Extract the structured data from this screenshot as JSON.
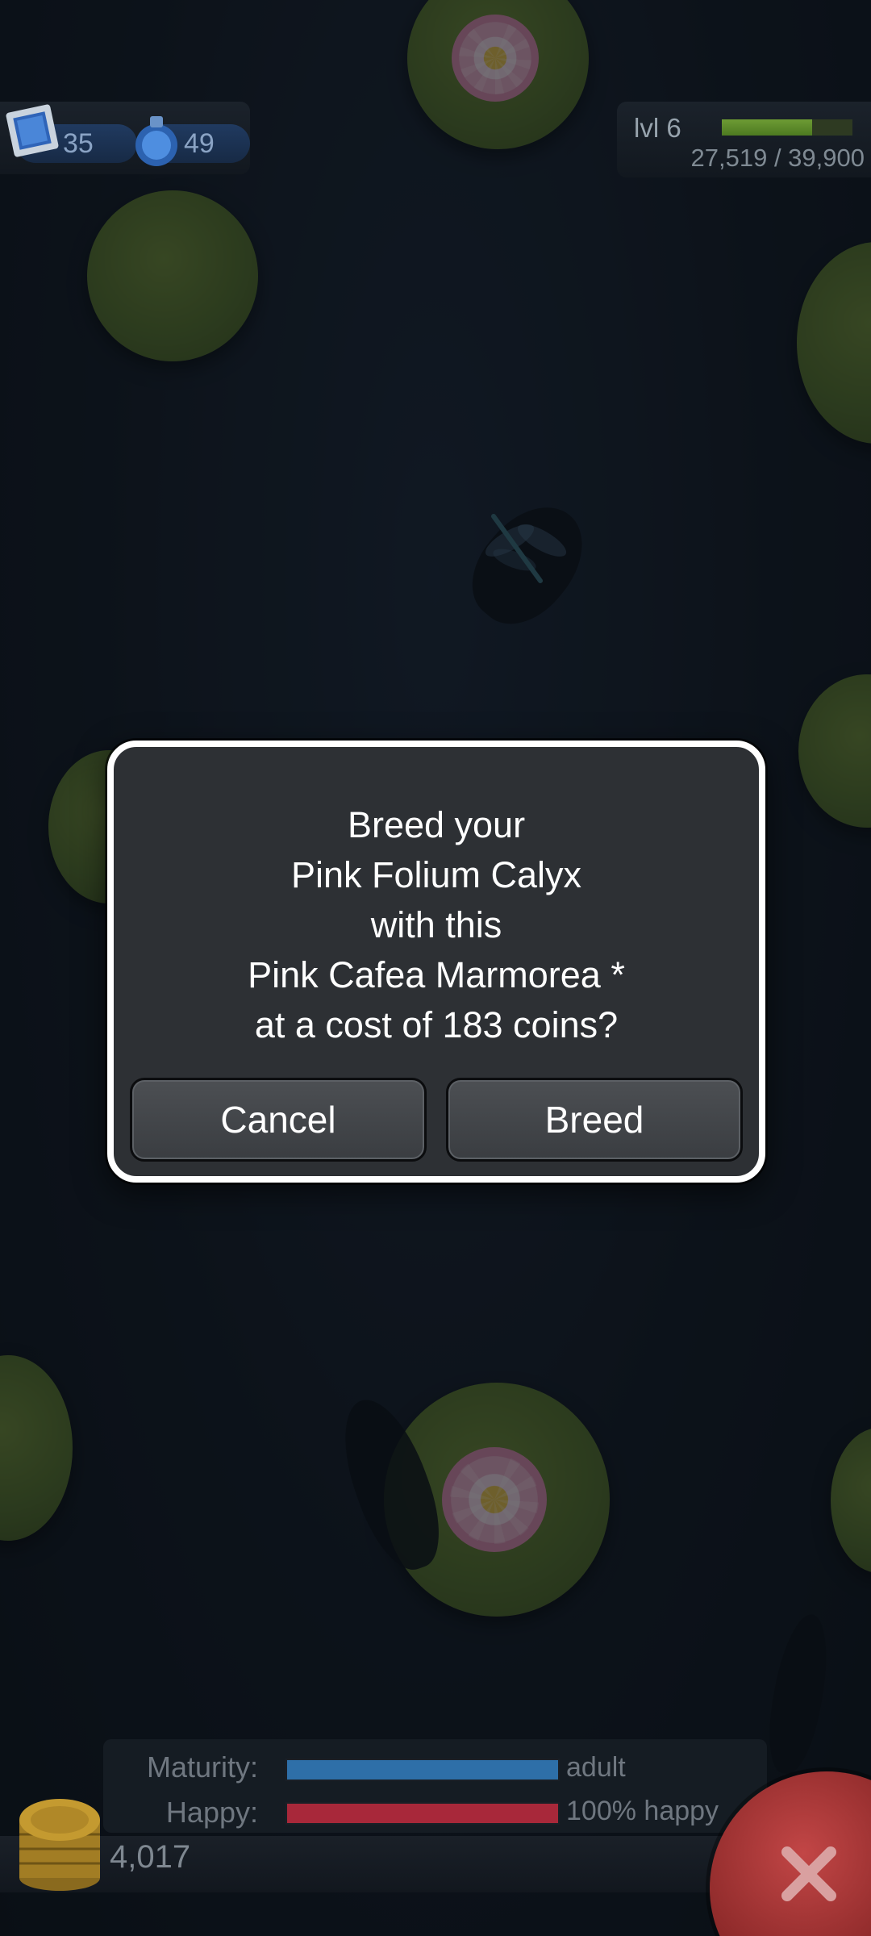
{
  "hud": {
    "stamps": "35",
    "potions": "49",
    "level_label": "lvl 6",
    "xp_text": "27,519 / 39,900",
    "xp_progress": 0.69
  },
  "dialog": {
    "lines": [
      "Breed your",
      "Pink Folium Calyx",
      "with this",
      "Pink Cafea Marmorea *",
      "at a cost of 183 coins?"
    ],
    "cancel_label": "Cancel",
    "breed_label": "Breed"
  },
  "stats": {
    "maturity_label": "Maturity:",
    "maturity_value": "adult",
    "maturity_progress": 1.0,
    "maturity_color": "#2e6fa8",
    "happy_label": "Happy:",
    "happy_value": "100% happy",
    "happy_progress": 1.0,
    "happy_color": "#a8283a"
  },
  "coins": {
    "count": "4,017"
  },
  "icons": {
    "stamp": "blue-stamp-icon",
    "potion": "potion-icon",
    "coins": "coin-stack-icon",
    "close": "close-icon"
  }
}
